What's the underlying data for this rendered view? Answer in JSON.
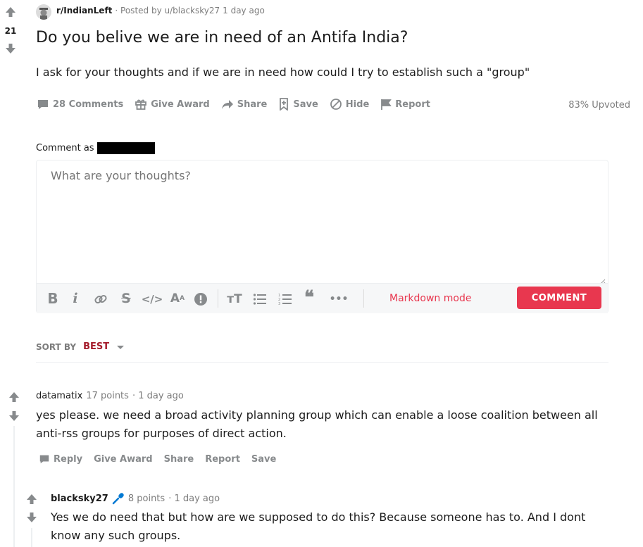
{
  "post": {
    "votes": "21",
    "subreddit": "r/IndianLeft",
    "posted_by": "· Posted by u/blacksky27",
    "age": "1 day ago",
    "title": "Do you belive we are in need of an Antifa India?",
    "body": "I ask for your thoughts and if we are in need how could I try to establish such a \"group\"",
    "actions": {
      "comments": "28 Comments",
      "give_award": "Give Award",
      "share": "Share",
      "save": "Save",
      "hide": "Hide",
      "report": "Report"
    },
    "upvoted": "83% Upvoted"
  },
  "comment_box": {
    "comment_as": "Comment as",
    "placeholder": "What are your thoughts?",
    "markdown_mode": "Markdown mode",
    "submit": "COMMENT"
  },
  "sort": {
    "label": "SORT BY",
    "value": "BEST"
  },
  "comments": [
    {
      "author": "datamatix",
      "points": "17 points",
      "age": "· 1 day ago",
      "text_line1": "yes please. we need a broad activity planning group which can enable a loose coalition between all",
      "text_line2": "anti-rss groups for purposes of direct action.",
      "actions": [
        "Reply",
        "Give Award",
        "Share",
        "Report",
        "Save"
      ]
    },
    {
      "author": "blacksky27",
      "points": "8 points",
      "age": "· 1 day ago",
      "text_line1": "Yes we do need that but how are we supposed to do this? Because someone has to. And I dont",
      "text_line2": "know any such groups."
    }
  ],
  "colors": {
    "accent": "#e8374f",
    "sort_value": "#a41a2a",
    "muted": "#878a8c",
    "mic": "#0079d3"
  }
}
